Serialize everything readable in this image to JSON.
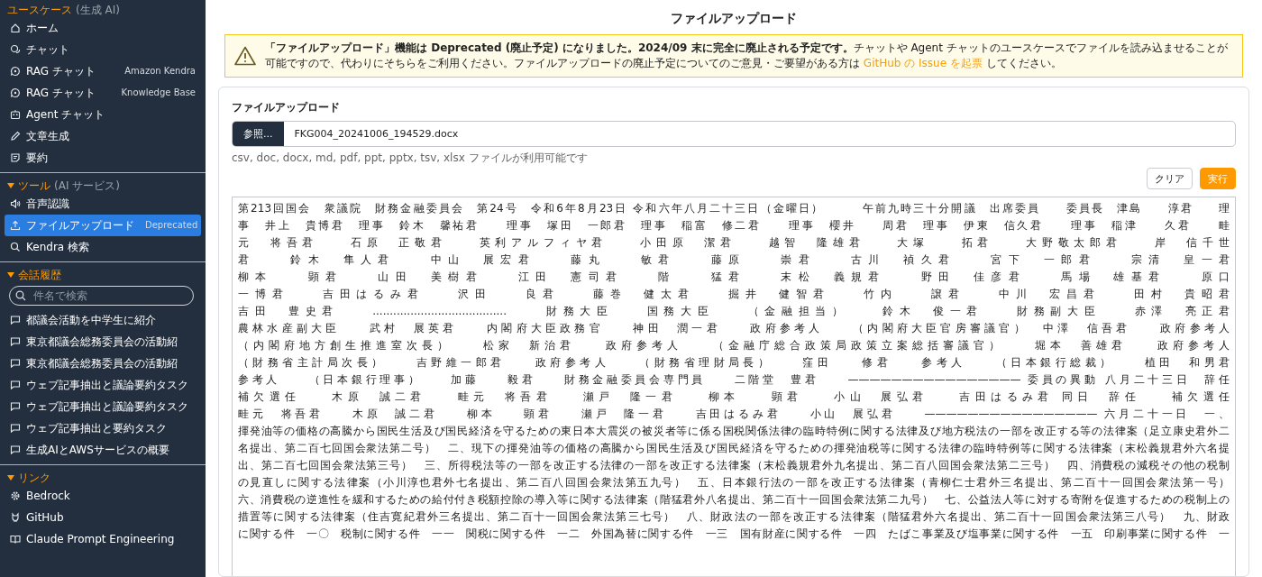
{
  "sidebar": {
    "sections": [
      {
        "kind": "plain",
        "title": "ユースケース",
        "subtitle": "(生成 AI)",
        "expanded": true,
        "items": [
          {
            "label": "ホーム",
            "selected": false
          },
          {
            "label": "チャット",
            "selected": false
          },
          {
            "label": "RAG チャット",
            "badge": "Amazon Kendra",
            "selected": false
          },
          {
            "label": "RAG チャット",
            "badge": "Knowledge Base",
            "selected": false
          },
          {
            "label": "Agent チャット",
            "selected": false
          },
          {
            "label": "文章生成",
            "selected": false
          },
          {
            "label": "要約",
            "selected": false
          }
        ]
      },
      {
        "kind": "collapsible",
        "title": "ツール",
        "subtitle": "(AI サービス)",
        "expanded": true,
        "items": [
          {
            "label": "音声認識",
            "selected": false
          },
          {
            "label": "ファイルアップロード",
            "badge": "Deprecated",
            "selected": true
          },
          {
            "label": "Kendra 検索",
            "selected": false
          }
        ]
      },
      {
        "kind": "collapsible",
        "title": "会話履歴",
        "expanded": true,
        "search": {
          "placeholder": "件名で検索"
        },
        "items": [
          {
            "label": "都議会活動を中学生に紹介",
            "selected": false
          },
          {
            "label": "東京都議会総務委員会の活動紹",
            "selected": false
          },
          {
            "label": "東京都議会総務委員会の活動紹",
            "selected": false
          },
          {
            "label": "ウェブ記事抽出と議論要約タスク",
            "selected": false
          },
          {
            "label": "ウェブ記事抽出と議論要約タスク",
            "selected": false
          },
          {
            "label": "ウェブ記事抽出と要約タスク",
            "selected": false
          },
          {
            "label": "生成AIとAWSサービスの概要",
            "selected": false
          }
        ]
      },
      {
        "kind": "collapsible",
        "title": "リンク",
        "expanded": true,
        "items": [
          {
            "label": "Bedrock",
            "selected": false
          },
          {
            "label": "GitHub",
            "selected": false
          },
          {
            "label": "Claude Prompt Engineering",
            "selected": false
          }
        ]
      }
    ]
  },
  "page": {
    "title": "ファイルアップロード"
  },
  "warning": {
    "text": "**「ファイルアップロード」機能は Deprecated (廃止予定) になりました。2024/09 末に完全に廃止される予定です。**チャットや Agent チャットのユースケースでファイルを読み込ませることが可能ですので、代わりにそちらをご利用ください。ファイルアップロードの廃止予定についてのご意見・ご要望がある方は ",
    "link": "GitHub の Issue を起票",
    "after": " してください。"
  },
  "upload": {
    "label": "ファイルアップロード",
    "browse_button": "参照...",
    "file_name": "FKG004_20241006_194529.docx",
    "hint": "csv, doc, docx, md, pdf, ppt, pptx, tsv, xlsx ファイルが利用可能です",
    "buttons": [
      {
        "kind": "secondary",
        "label": "クリア"
      },
      {
        "kind": "primary",
        "label": "実行"
      }
    ]
  },
  "document": {
    "lines": [
      "第213回国会　衆議院　財務金融委員会　第24号　令和6年8月23日 令和六年八月二十三日（金曜日）　　　午前九時三十分開議　出席委員　　委員長　津島　　淳君　　理",
      "事　井上　貴博君　理事　鈴木　馨祐君　　理事　塚田　一郎君　理事　稲富　修二君　　理事　櫻井　　周君　理事　伊東　信久君　　理事　稲津　　久君　　畦",
      "元　将吾君　　石原　正敬君　　英利アルフィヤ君　　小田原　潔君　　越智　隆雄君　　大塚　　拓君　　大野敬太郎君　　岸　信千世",
      "君　　鈴木　隼人君　　中山　展宏君　　藤丸　　敏君　　藤原　　崇君　　古川　禎久君　　宮下　一郎君　　宗清　皇一君",
      "柳本　　顕君　　山田　美樹君　　江田　憲司君　　階　　猛君　　末松　義規君　　野田　佳彦君　　馬場　雄基君　　原口",
      "一博君　　吉田はるみ君　　沢田　　良君　　藤巻　健太君　　掘井　健智君　　竹内　　譲君　　中川　宏昌君　　田村　貴昭君",
      "吉田　豊史君　　.......................................　　財務大臣　　国務大臣　　（金融担当）　　鈴木　俊一君　　財務副大臣　　赤澤　亮正君",
      "農林水産副大臣　　武村　展英君　　内閣府大臣政務官　　神田　潤一君　　政府参考人　　（内閣府大臣官房審議官）　中澤　信吾君　　政府参考人",
      "（内閣府地方創生推進室次長）　　松家　新治君　　政府参考人　　（金融庁総合政策局政策立案総括審議官）　　堀本　善雄君　　政府参考人",
      "（財務省主計局次長）　　吉野維一郎君　　政府参考人　　（財務省理財局長）　　窪田　　修君　　参考人　　（日本銀行総裁）　　植田　和男君",
      "参考人　　（日本銀行理事）　　加藤　　毅君　　財務金融委員会専門員　　二階堂　豊君　　———————————————— 委員の異動 八月二十三日　辞任",
      "補欠選任　　木原　誠二君　　畦元　将吾君　　瀬戸　隆一君　　柳本　　顕君　　小山　展弘君　　吉田はるみ君 同日　辞任　　補欠選任",
      "畦元　将吾君　　木原　誠二君　　柳本　　顕君　　瀬戸　隆一君　　吉田はるみ君　　小山　展弘君　　———————————————— 六月二十一日　一、",
      "揮発油等の価格の高騰から国民生活及び国民経済を守るための東日本大震災の被災者等に係る国税関係法律の臨時特例に関する法律及び地方税法の一部を改正する等の法律案（足立康史君外二",
      "名提出、第二百七回国会衆法第二号）　二、現下の揮発油等の価格の高騰から国民生活及び国民経済を守るための揮発油税等に関する法律の臨時特例等に関する法律案（末松義規君外六名提",
      "出、第二百七回国会衆法第三号）　三、所得税法等の一部を改正する法律の一部を改正する法律案（末松義規君外九名提出、第二百八回国会衆法第二三号）　四、消費税の減税その他の税制",
      "の見直しに関する法律案（小川淳也君外七名提出、第二百八回国会衆法第五九号）　五、日本銀行法の一部を改正する法律案（青柳仁士君外三名提出、第二百十一回国会衆法第一号）",
      "六、消費税の逆進性を緩和するための給付付き税額控除の導入等に関する法律案（階猛君外八名提出、第二百十一回国会衆法第二九号）　七、公益法人等に対する寄附を促進するための税制上の",
      "措置等に関する法律案（住吉寛紀君外三名提出、第二百十一回国会衆法第三七号）　八、財政法の一部を改正する法律案（階猛君外六名提出、第二百十一回国会衆法第三八号）　九、財政",
      "に関する件　一〇　税制に関する件　一一　関税に関する件　一二　外国為替に関する件　一三　国有財産に関する件　一四　たばこ事業及び塩事業に関する件　一五　印刷事業に関する件　一"
    ]
  }
}
